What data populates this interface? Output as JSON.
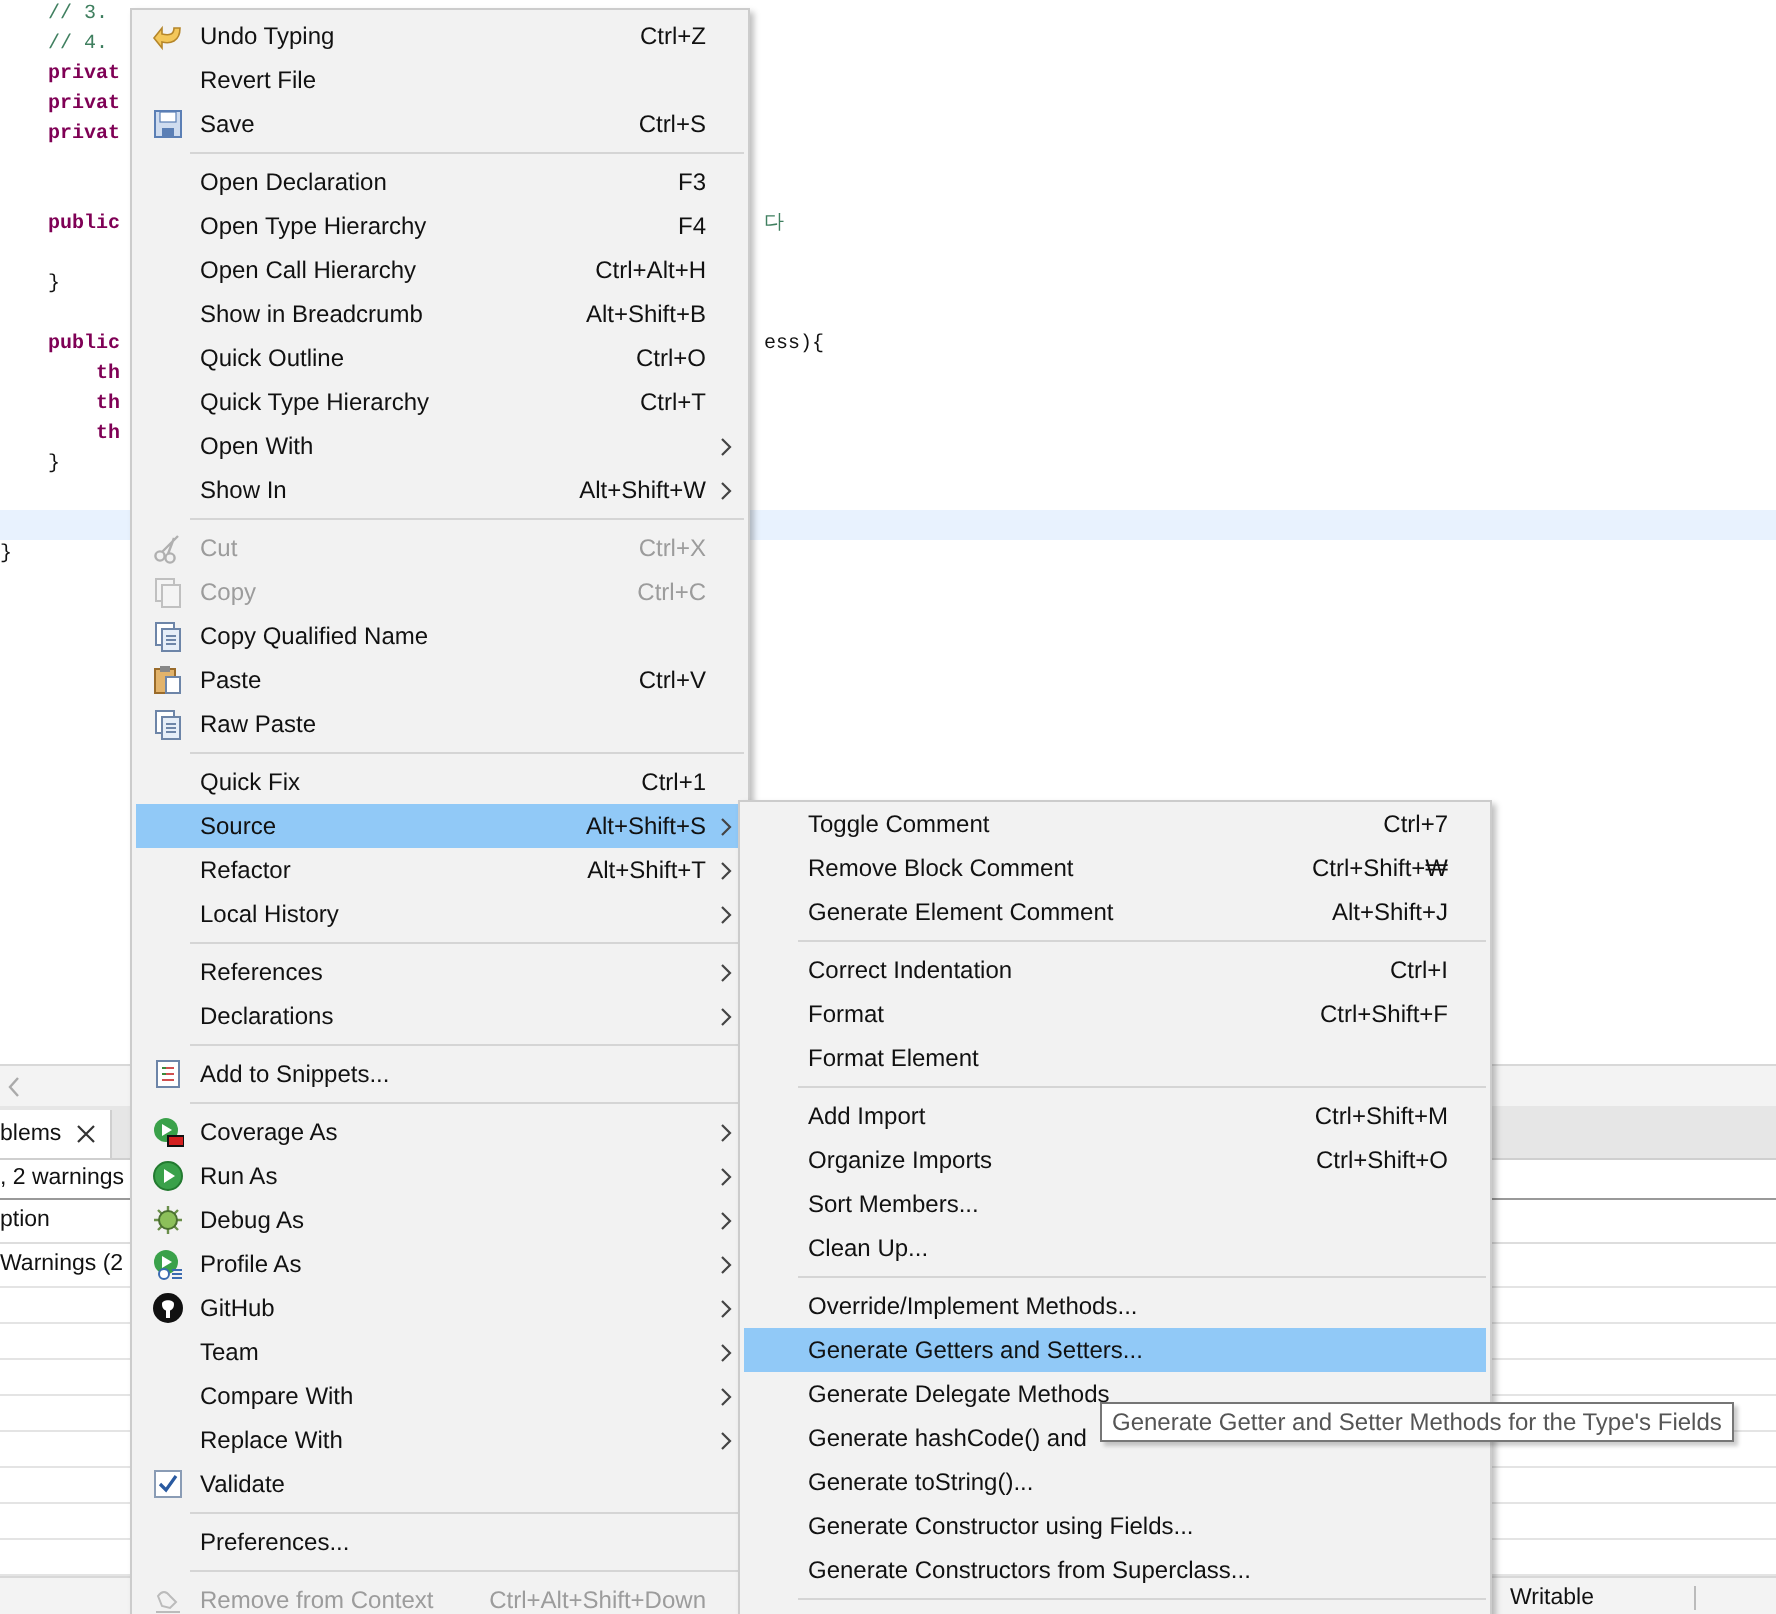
{
  "editor": {
    "lines": [
      {
        "kind": "comment",
        "text": "    // 3.",
        "current": false
      },
      {
        "kind": "comment",
        "text": "    // 4.",
        "current": false
      },
      {
        "kind": "keyword",
        "text": "    privat",
        "current": false
      },
      {
        "kind": "keyword",
        "text": "    privat",
        "current": false
      },
      {
        "kind": "keyword",
        "text": "    privat",
        "current": false
      },
      {
        "kind": "blank",
        "current": false
      },
      {
        "kind": "blank",
        "current": false
      },
      {
        "kind": "keyword",
        "text": "    public",
        "right": {
          "kind": "comment",
          "text": "다"
        },
        "current": false
      },
      {
        "kind": "blank",
        "current": false
      },
      {
        "kind": "plain",
        "text": "    }",
        "current": false
      },
      {
        "kind": "blank",
        "current": false
      },
      {
        "kind": "keyword",
        "text": "    public",
        "right": {
          "kind": "plain",
          "text": "ess){"
        },
        "current": false
      },
      {
        "kind": "keyword",
        "text": "        th",
        "current": false
      },
      {
        "kind": "keyword",
        "text": "        th",
        "current": false
      },
      {
        "kind": "keyword",
        "text": "        th",
        "current": false
      },
      {
        "kind": "plain",
        "text": "    }",
        "current": false
      },
      {
        "kind": "blank",
        "current": false
      },
      {
        "kind": "blank",
        "current": true
      },
      {
        "kind": "plain",
        "text": "}",
        "current": false
      }
    ]
  },
  "context_menu": {
    "items": [
      {
        "kind": "item",
        "label": "Undo Typing",
        "shortcut": "Ctrl+Z",
        "disabled": false,
        "selected": false,
        "submenu": false
      },
      {
        "kind": "item",
        "label": "Revert File",
        "disabled": false,
        "selected": false,
        "submenu": false
      },
      {
        "kind": "item",
        "label": "Save",
        "shortcut": "Ctrl+S",
        "disabled": false,
        "selected": false,
        "submenu": false
      },
      {
        "kind": "separator"
      },
      {
        "kind": "item",
        "label": "Open Declaration",
        "shortcut": "F3",
        "disabled": false,
        "selected": false,
        "submenu": false
      },
      {
        "kind": "item",
        "label": "Open Type Hierarchy",
        "shortcut": "F4",
        "disabled": false,
        "selected": false,
        "submenu": false
      },
      {
        "kind": "item",
        "label": "Open Call Hierarchy",
        "shortcut": "Ctrl+Alt+H",
        "disabled": false,
        "selected": false,
        "submenu": false
      },
      {
        "kind": "item",
        "label": "Show in Breadcrumb",
        "shortcut": "Alt+Shift+B",
        "disabled": false,
        "selected": false,
        "submenu": false
      },
      {
        "kind": "item",
        "label": "Quick Outline",
        "shortcut": "Ctrl+O",
        "disabled": false,
        "selected": false,
        "submenu": false
      },
      {
        "kind": "item",
        "label": "Quick Type Hierarchy",
        "shortcut": "Ctrl+T",
        "disabled": false,
        "selected": false,
        "submenu": false
      },
      {
        "kind": "item",
        "label": "Open With",
        "disabled": false,
        "selected": false,
        "submenu": true
      },
      {
        "kind": "item",
        "label": "Show In",
        "shortcut": "Alt+Shift+W",
        "disabled": false,
        "selected": false,
        "submenu": true
      },
      {
        "kind": "separator"
      },
      {
        "kind": "item",
        "label": "Cut",
        "shortcut": "Ctrl+X",
        "disabled": true,
        "selected": false,
        "submenu": false
      },
      {
        "kind": "item",
        "label": "Copy",
        "shortcut": "Ctrl+C",
        "disabled": true,
        "selected": false,
        "submenu": false
      },
      {
        "kind": "item",
        "label": "Copy Qualified Name",
        "disabled": false,
        "selected": false,
        "submenu": false
      },
      {
        "kind": "item",
        "label": "Paste",
        "shortcut": "Ctrl+V",
        "disabled": false,
        "selected": false,
        "submenu": false
      },
      {
        "kind": "item",
        "label": "Raw Paste",
        "disabled": false,
        "selected": false,
        "submenu": false
      },
      {
        "kind": "separator"
      },
      {
        "kind": "item",
        "label": "Quick Fix",
        "shortcut": "Ctrl+1",
        "disabled": false,
        "selected": false,
        "submenu": false
      },
      {
        "kind": "item",
        "label": "Source",
        "shortcut": "Alt+Shift+S",
        "disabled": false,
        "selected": true,
        "submenu": true
      },
      {
        "kind": "item",
        "label": "Refactor",
        "shortcut": "Alt+Shift+T",
        "disabled": false,
        "selected": false,
        "submenu": true
      },
      {
        "kind": "item",
        "label": "Local History",
        "disabled": false,
        "selected": false,
        "submenu": true
      },
      {
        "kind": "separator"
      },
      {
        "kind": "item",
        "label": "References",
        "disabled": false,
        "selected": false,
        "submenu": true
      },
      {
        "kind": "item",
        "label": "Declarations",
        "disabled": false,
        "selected": false,
        "submenu": true
      },
      {
        "kind": "separator"
      },
      {
        "kind": "item",
        "label": "Add to Snippets...",
        "disabled": false,
        "selected": false,
        "submenu": false
      },
      {
        "kind": "separator"
      },
      {
        "kind": "item",
        "label": "Coverage As",
        "disabled": false,
        "selected": false,
        "submenu": true
      },
      {
        "kind": "item",
        "label": "Run As",
        "disabled": false,
        "selected": false,
        "submenu": true
      },
      {
        "kind": "item",
        "label": "Debug As",
        "disabled": false,
        "selected": false,
        "submenu": true
      },
      {
        "kind": "item",
        "label": "Profile As",
        "disabled": false,
        "selected": false,
        "submenu": true
      },
      {
        "kind": "item",
        "label": "GitHub",
        "disabled": false,
        "selected": false,
        "submenu": true
      },
      {
        "kind": "item",
        "label": "Team",
        "disabled": false,
        "selected": false,
        "submenu": true
      },
      {
        "kind": "item",
        "label": "Compare With",
        "disabled": false,
        "selected": false,
        "submenu": true
      },
      {
        "kind": "item",
        "label": "Replace With",
        "disabled": false,
        "selected": false,
        "submenu": true
      },
      {
        "kind": "check",
        "label": "Validate",
        "checked": true,
        "disabled": false,
        "selected": false,
        "submenu": false
      },
      {
        "kind": "separator"
      },
      {
        "kind": "item",
        "label": "Preferences...",
        "disabled": false,
        "selected": false,
        "submenu": false
      },
      {
        "kind": "separator"
      },
      {
        "kind": "item",
        "label": "Remove from Context",
        "shortcut": "Ctrl+Alt+Shift+Down",
        "disabled": true,
        "selected": false,
        "submenu": false
      }
    ]
  },
  "source_submenu": {
    "items": [
      {
        "kind": "item",
        "label": "Toggle Comment",
        "shortcut": "Ctrl+7",
        "selected": false
      },
      {
        "kind": "item",
        "label": "Remove Block Comment",
        "shortcut": "Ctrl+Shift+₩",
        "selected": false
      },
      {
        "kind": "item",
        "label": "Generate Element Comment",
        "shortcut": "Alt+Shift+J",
        "selected": false
      },
      {
        "kind": "separator"
      },
      {
        "kind": "item",
        "label": "Correct Indentation",
        "shortcut": "Ctrl+I",
        "selected": false
      },
      {
        "kind": "item",
        "label": "Format",
        "shortcut": "Ctrl+Shift+F",
        "selected": false
      },
      {
        "kind": "item",
        "label": "Format Element",
        "selected": false
      },
      {
        "kind": "separator"
      },
      {
        "kind": "item",
        "label": "Add Import",
        "shortcut": "Ctrl+Shift+M",
        "selected": false
      },
      {
        "kind": "item",
        "label": "Organize Imports",
        "shortcut": "Ctrl+Shift+O",
        "selected": false
      },
      {
        "kind": "item",
        "label": "Sort Members...",
        "selected": false
      },
      {
        "kind": "item",
        "label": "Clean Up...",
        "selected": false
      },
      {
        "kind": "separator"
      },
      {
        "kind": "item",
        "label": "Override/Implement Methods...",
        "selected": false
      },
      {
        "kind": "item",
        "label": "Generate Getters and Setters...",
        "selected": true
      },
      {
        "kind": "item",
        "label": "Generate Delegate Methods",
        "selected": false
      },
      {
        "kind": "item",
        "label": "Generate hashCode() and",
        "selected": false
      },
      {
        "kind": "item",
        "label": "Generate toString()...",
        "selected": false
      },
      {
        "kind": "item",
        "label": "Generate Constructor using Fields...",
        "selected": false
      },
      {
        "kind": "item",
        "label": "Generate Constructors from Superclass...",
        "selected": false
      },
      {
        "kind": "separator"
      }
    ]
  },
  "tooltip": {
    "text": "Generate Getter and Setter Methods for the Type's Fields"
  },
  "problems_panel": {
    "tab": {
      "label": "blems",
      "selected": true
    },
    "summary": ", 2 warnings",
    "column_header": "ption",
    "rows": [
      {
        "text": "Warnings (2"
      }
    ]
  },
  "status_bar": {
    "text": "Writable"
  }
}
